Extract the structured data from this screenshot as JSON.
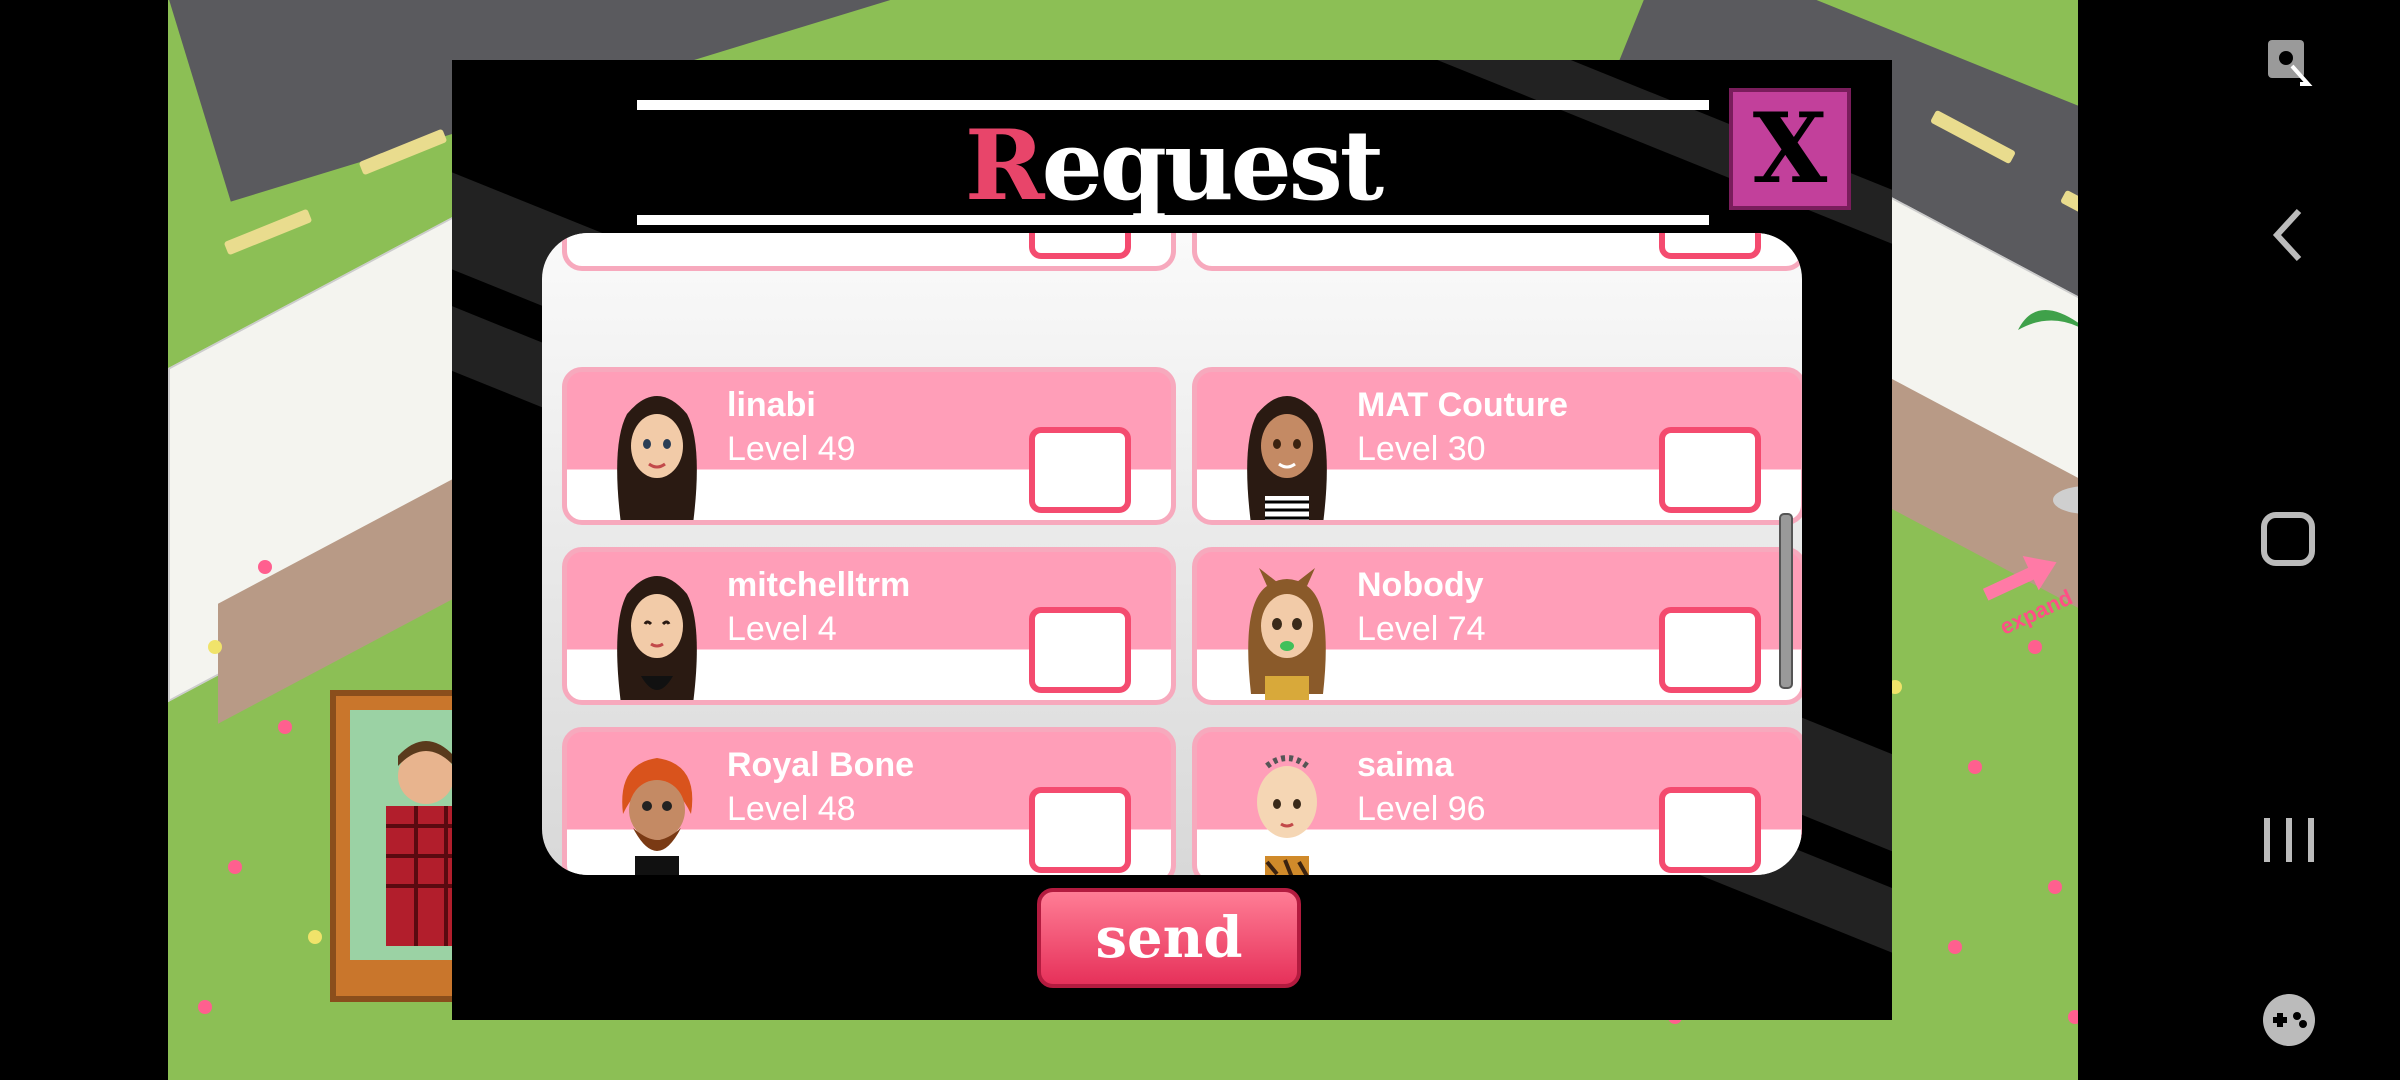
{
  "dialog": {
    "title_first": "R",
    "title_rest": "equest",
    "close_label": "X",
    "send_label": "send"
  },
  "friends": [
    {
      "name": "linabi",
      "level": "Level 49",
      "checked": false
    },
    {
      "name": "MAT Couture",
      "level": "Level 30",
      "checked": false
    },
    {
      "name": "mitchelltrm",
      "level": "Level 4",
      "checked": false
    },
    {
      "name": "Nobody",
      "level": "Level 74",
      "checked": false
    },
    {
      "name": "Royal Bone",
      "level": "Level 48",
      "checked": false
    },
    {
      "name": "saima",
      "level": "Level 96",
      "checked": false
    }
  ],
  "game": {
    "expand_label": "expand"
  },
  "colors": {
    "accent": "#e8456a",
    "card_pink": "#ff9eb8",
    "checkbox_border": "#f44b6f",
    "close_bg": "#c2409b"
  }
}
